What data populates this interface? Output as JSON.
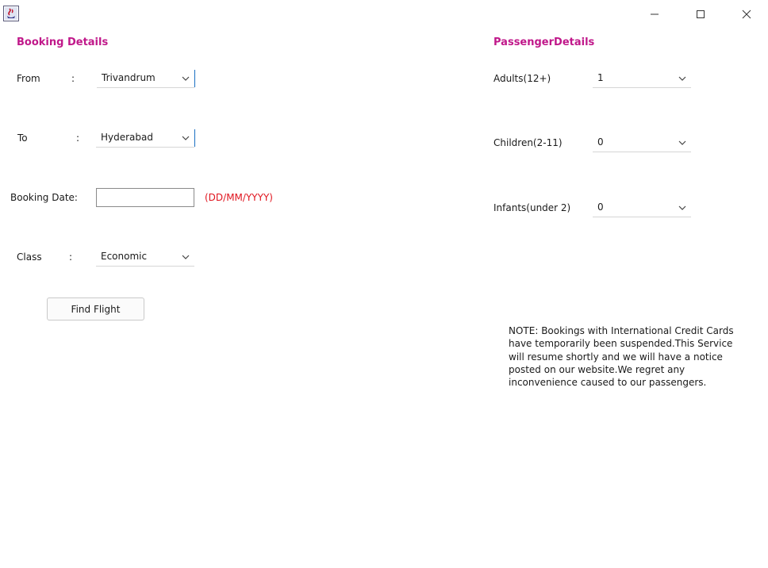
{
  "window": {
    "app_icon": "java-cup-icon",
    "controls": [
      "minimize-icon",
      "maximize-icon",
      "close-icon"
    ]
  },
  "booking": {
    "title": "Booking Details",
    "from_label": "From",
    "from_value": "Trivandrum",
    "to_label": "To",
    "to_value": "Hyderabad",
    "date_label": "Booking Date:",
    "date_value": "",
    "date_hint": "(DD/MM/YYYY)",
    "class_label": "Class",
    "class_value": "Economic",
    "colon": ":",
    "find_button": "Find Flight"
  },
  "passenger": {
    "title": "PassengerDetails",
    "adults_label": "Adults(12+)",
    "adults_value": "1",
    "children_label": "Children(2-11)",
    "children_value": "0",
    "infants_label": "Infants(under 2)",
    "infants_value": "0"
  },
  "note": "NOTE: Bookings with International Credit Cards\nhave temporarily been suspended.This Service\nwill resume shortly and we will have a notice\nposted on our website.We regret any\ninconvenience caused to our passengers.",
  "colors": {
    "section_title": "#c0188a",
    "date_hint": "#e0141e"
  }
}
